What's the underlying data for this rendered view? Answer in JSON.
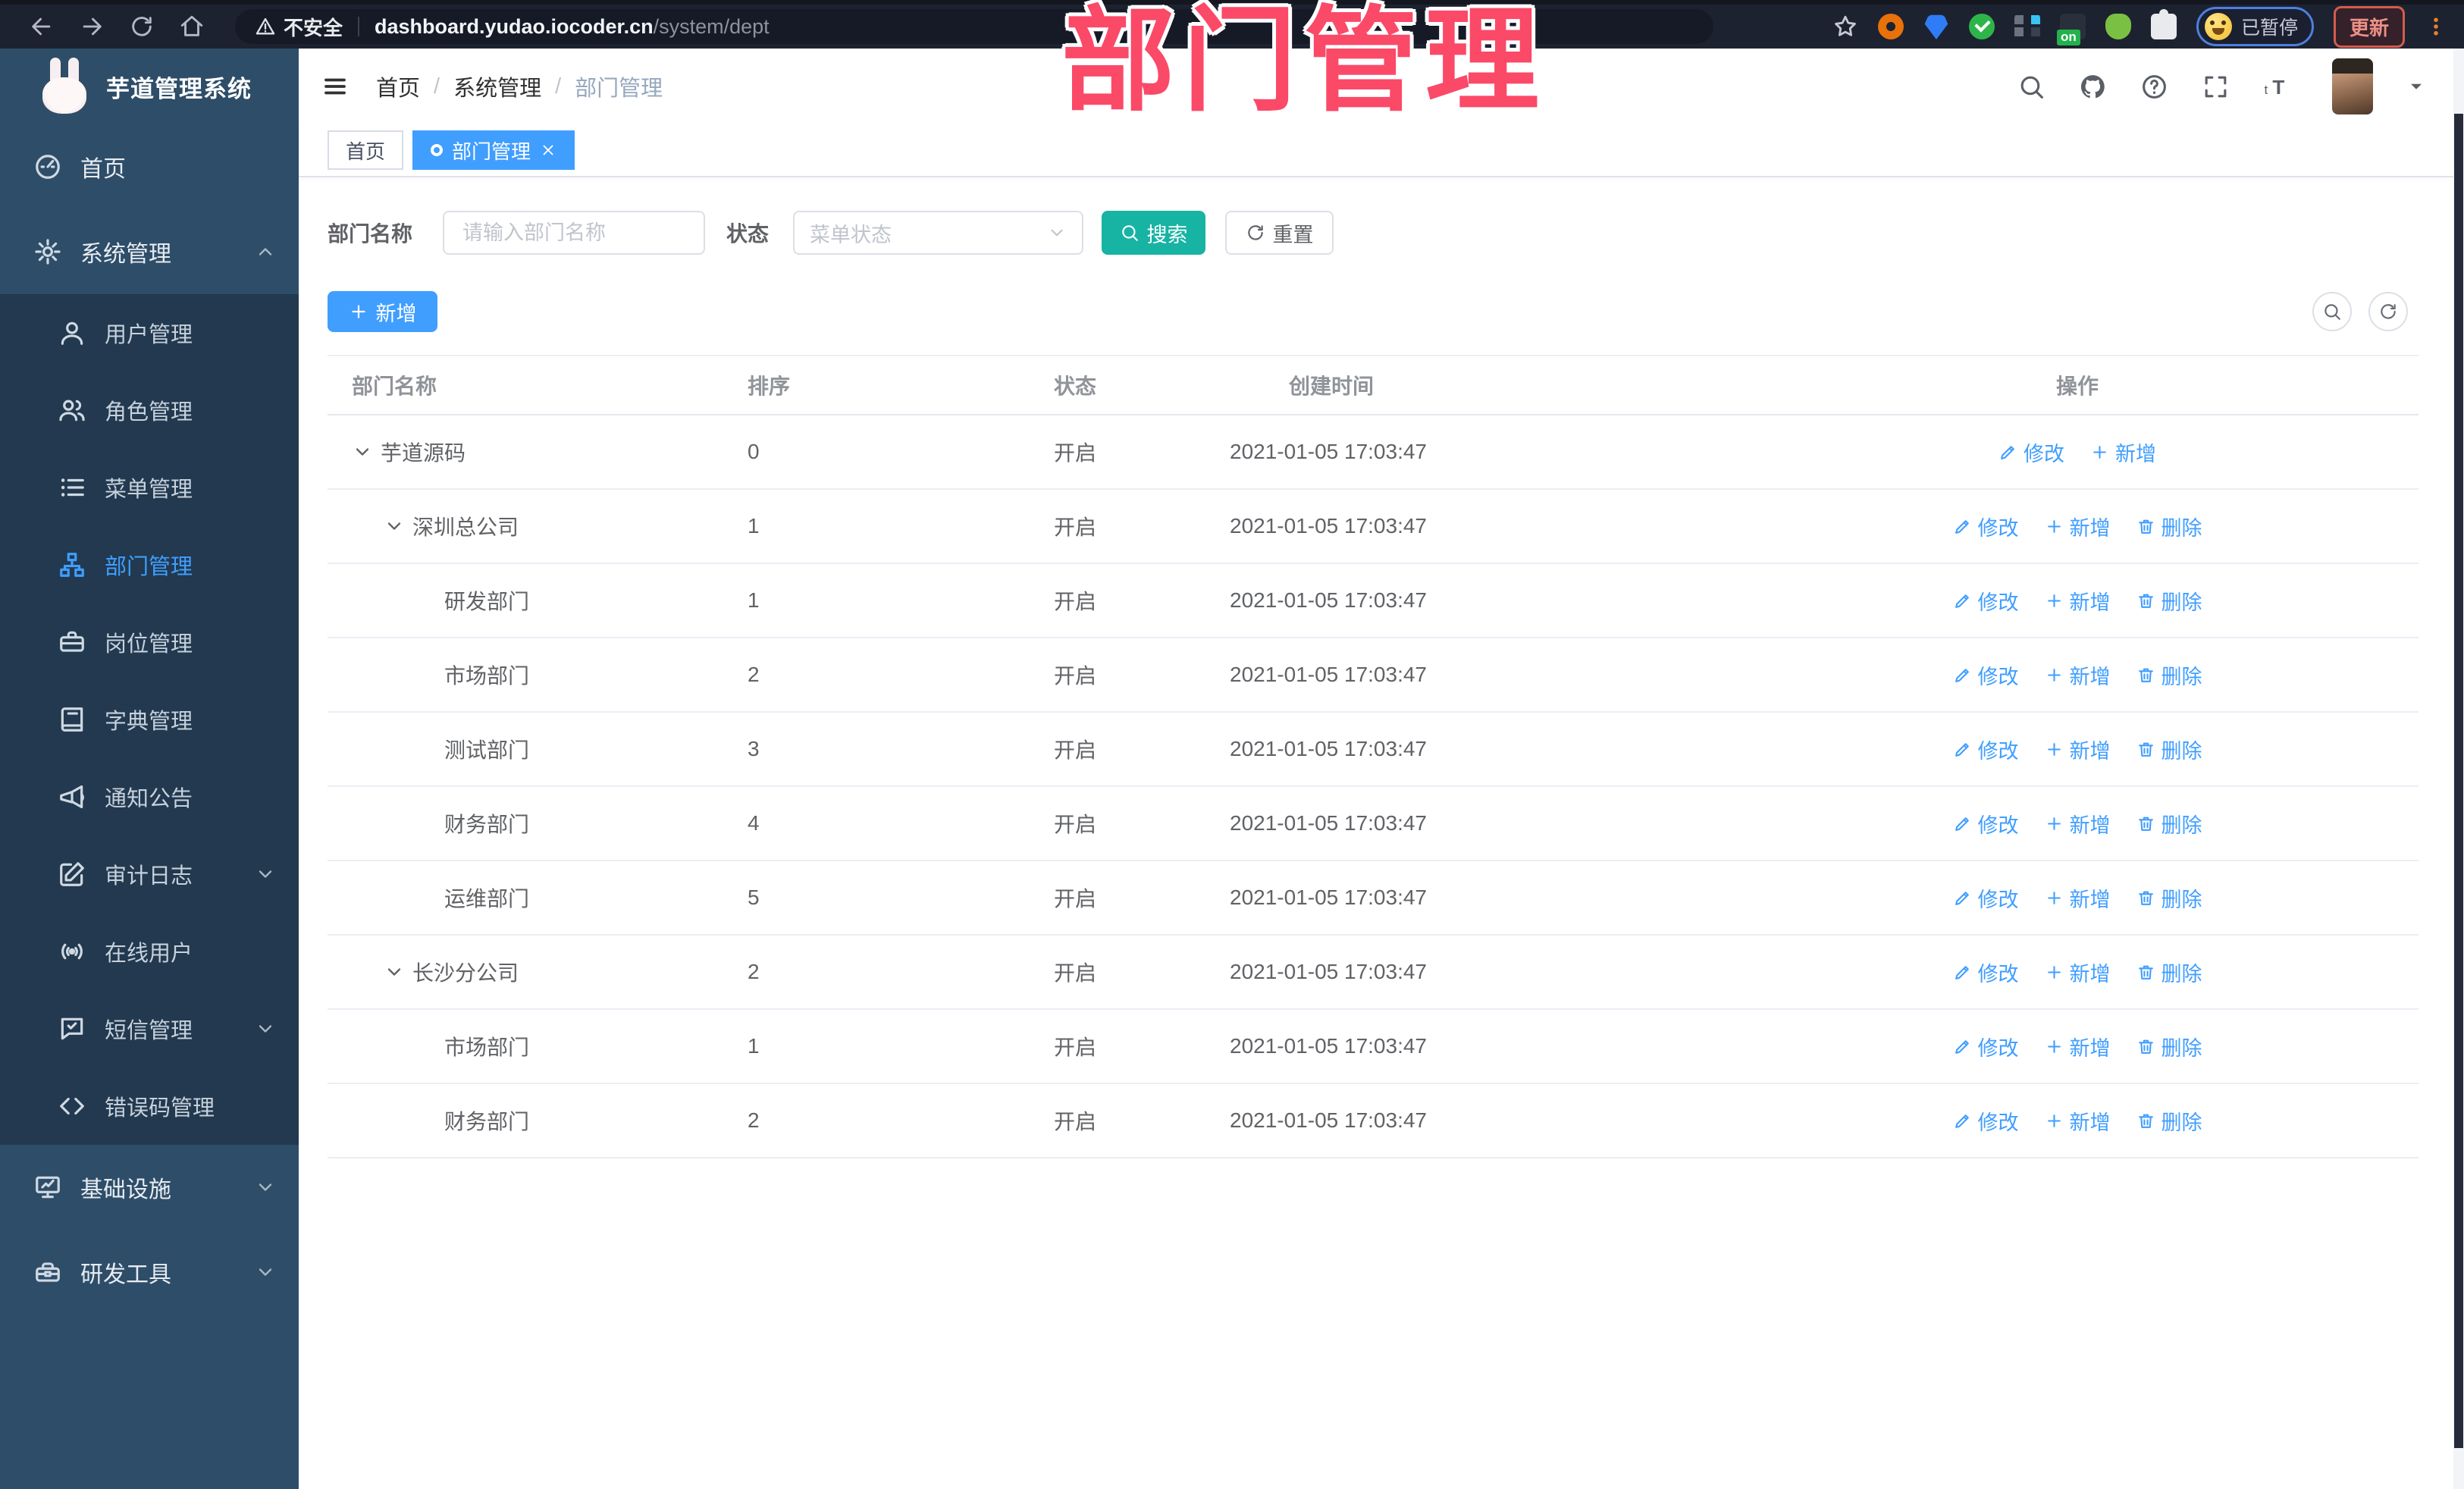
{
  "browser": {
    "security_label": "不安全",
    "url_host": "dashboard.yudao.iocoder.cn",
    "url_path": "/system/dept",
    "profile_status": "已暂停",
    "update_label": "更新",
    "ext_badge": "on"
  },
  "watermark": "部门管理",
  "app_header": {
    "logo_title": "芋道管理系统",
    "breadcrumb": [
      "首页",
      "系统管理",
      "部门管理"
    ]
  },
  "tabs": [
    {
      "label": "首页",
      "active": false
    },
    {
      "label": "部门管理",
      "active": true
    }
  ],
  "sidebar": {
    "items": [
      {
        "id": "home",
        "icon": "dashboard-icon",
        "label": "首页"
      },
      {
        "id": "system",
        "icon": "gear-icon",
        "label": "系统管理",
        "expanded": true,
        "children": [
          {
            "id": "user",
            "icon": "user-icon",
            "label": "用户管理"
          },
          {
            "id": "role",
            "icon": "users-icon",
            "label": "角色管理"
          },
          {
            "id": "menu",
            "icon": "menu-list-icon",
            "label": "菜单管理"
          },
          {
            "id": "dept",
            "icon": "org-tree-icon",
            "label": "部门管理",
            "active": true
          },
          {
            "id": "post",
            "icon": "briefcase-icon",
            "label": "岗位管理"
          },
          {
            "id": "dict",
            "icon": "book-icon",
            "label": "字典管理"
          },
          {
            "id": "notice",
            "icon": "megaphone-icon",
            "label": "通知公告"
          },
          {
            "id": "audit",
            "icon": "edit-square-icon",
            "label": "审计日志",
            "expandable": true
          },
          {
            "id": "online",
            "icon": "online-icon",
            "label": "在线用户"
          },
          {
            "id": "sms",
            "icon": "message-icon",
            "label": "短信管理",
            "expandable": true
          },
          {
            "id": "errcode",
            "icon": "code-icon",
            "label": "错误码管理"
          }
        ]
      },
      {
        "id": "infra",
        "icon": "monitor-icon",
        "label": "基础设施",
        "expandable": true
      },
      {
        "id": "devtool",
        "icon": "toolbox-icon",
        "label": "研发工具",
        "expandable": true
      }
    ]
  },
  "filters": {
    "dept_label": "部门名称",
    "dept_placeholder": "请输入部门名称",
    "status_label": "状态",
    "status_placeholder": "菜单状态",
    "search_label": "搜索",
    "reset_label": "重置"
  },
  "toolbar": {
    "add_label": "新增"
  },
  "table": {
    "headers": [
      "部门名称",
      "排序",
      "状态",
      "创建时间",
      "操作"
    ],
    "rows": [
      {
        "name": "芋道源码",
        "level": 0,
        "expandable": true,
        "sort": "0",
        "status": "开启",
        "created": "2021-01-05 17:03:47",
        "actions": [
          {
            "label": "修改",
            "icon": "edit-icon"
          },
          {
            "label": "新增",
            "icon": "plus-icon"
          }
        ]
      },
      {
        "name": "深圳总公司",
        "level": 1,
        "expandable": true,
        "sort": "1",
        "status": "开启",
        "created": "2021-01-05 17:03:47",
        "actions": [
          {
            "label": "修改",
            "icon": "edit-icon"
          },
          {
            "label": "新增",
            "icon": "plus-icon"
          },
          {
            "label": "删除",
            "icon": "trash-icon"
          }
        ]
      },
      {
        "name": "研发部门",
        "level": 2,
        "expandable": false,
        "sort": "1",
        "status": "开启",
        "created": "2021-01-05 17:03:47",
        "actions": [
          {
            "label": "修改",
            "icon": "edit-icon"
          },
          {
            "label": "新增",
            "icon": "plus-icon"
          },
          {
            "label": "删除",
            "icon": "trash-icon"
          }
        ]
      },
      {
        "name": "市场部门",
        "level": 2,
        "expandable": false,
        "sort": "2",
        "status": "开启",
        "created": "2021-01-05 17:03:47",
        "actions": [
          {
            "label": "修改",
            "icon": "edit-icon"
          },
          {
            "label": "新增",
            "icon": "plus-icon"
          },
          {
            "label": "删除",
            "icon": "trash-icon"
          }
        ]
      },
      {
        "name": "测试部门",
        "level": 2,
        "expandable": false,
        "sort": "3",
        "status": "开启",
        "created": "2021-01-05 17:03:47",
        "actions": [
          {
            "label": "修改",
            "icon": "edit-icon"
          },
          {
            "label": "新增",
            "icon": "plus-icon"
          },
          {
            "label": "删除",
            "icon": "trash-icon"
          }
        ]
      },
      {
        "name": "财务部门",
        "level": 2,
        "expandable": false,
        "sort": "4",
        "status": "开启",
        "created": "2021-01-05 17:03:47",
        "actions": [
          {
            "label": "修改",
            "icon": "edit-icon"
          },
          {
            "label": "新增",
            "icon": "plus-icon"
          },
          {
            "label": "删除",
            "icon": "trash-icon"
          }
        ]
      },
      {
        "name": "运维部门",
        "level": 2,
        "expandable": false,
        "sort": "5",
        "status": "开启",
        "created": "2021-01-05 17:03:47",
        "actions": [
          {
            "label": "修改",
            "icon": "edit-icon"
          },
          {
            "label": "新增",
            "icon": "plus-icon"
          },
          {
            "label": "删除",
            "icon": "trash-icon"
          }
        ]
      },
      {
        "name": "长沙分公司",
        "level": 1,
        "expandable": true,
        "sort": "2",
        "status": "开启",
        "created": "2021-01-05 17:03:47",
        "actions": [
          {
            "label": "修改",
            "icon": "edit-icon"
          },
          {
            "label": "新增",
            "icon": "plus-icon"
          },
          {
            "label": "删除",
            "icon": "trash-icon"
          }
        ]
      },
      {
        "name": "市场部门",
        "level": 2,
        "expandable": false,
        "sort": "1",
        "status": "开启",
        "created": "2021-01-05 17:03:47",
        "actions": [
          {
            "label": "修改",
            "icon": "edit-icon"
          },
          {
            "label": "新增",
            "icon": "plus-icon"
          },
          {
            "label": "删除",
            "icon": "trash-icon"
          }
        ]
      },
      {
        "name": "财务部门",
        "level": 2,
        "expandable": false,
        "sort": "2",
        "status": "开启",
        "created": "2021-01-05 17:03:47",
        "actions": [
          {
            "label": "修改",
            "icon": "edit-icon"
          },
          {
            "label": "新增",
            "icon": "plus-icon"
          },
          {
            "label": "删除",
            "icon": "trash-icon"
          }
        ]
      }
    ]
  },
  "colors": {
    "accent": "#409eff",
    "search_teal": "#17b3a3",
    "watermark_pink": "#fb4968",
    "sidebar_bg": "#2e4d68",
    "submenu_bg": "#22394f",
    "chrome_bg": "#1d2230"
  }
}
